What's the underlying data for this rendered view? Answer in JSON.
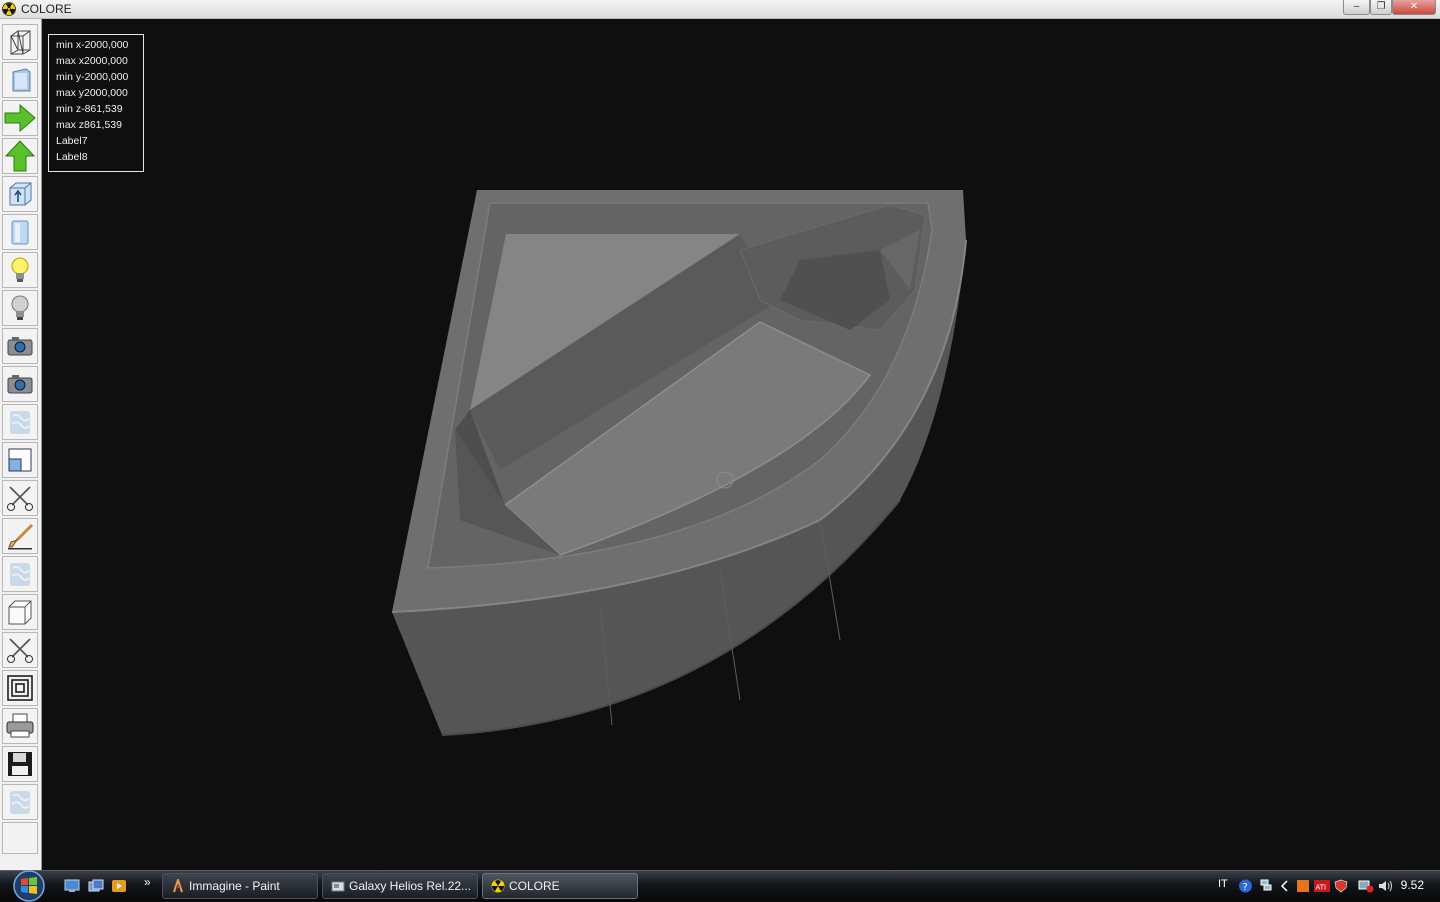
{
  "window": {
    "title": "COLORE",
    "icon": "radiation-icon"
  },
  "window_buttons": {
    "minimize": "–",
    "restore": "❐",
    "close": "✕"
  },
  "toolbar": {
    "tools": [
      {
        "name": "wireframe-tool-icon"
      },
      {
        "name": "solid-view-tool-icon"
      },
      {
        "name": "arrow-right-tool-icon"
      },
      {
        "name": "arrow-up-tool-icon"
      },
      {
        "name": "box-up-tool-icon"
      },
      {
        "name": "cylinder-tool-icon"
      },
      {
        "name": "light-on-tool-icon"
      },
      {
        "name": "light-off-tool-icon"
      },
      {
        "name": "camera-tool-icon"
      },
      {
        "name": "camera-2-tool-icon"
      },
      {
        "name": "texture-tool-icon"
      },
      {
        "name": "window-tool-icon"
      },
      {
        "name": "scissors-tool-icon"
      },
      {
        "name": "brush-tool-icon"
      },
      {
        "name": "texture-2-tool-icon"
      },
      {
        "name": "cube-tool-icon"
      },
      {
        "name": "scissors-2-tool-icon"
      },
      {
        "name": "concentric-squares-tool-icon"
      },
      {
        "name": "printer-tool-icon"
      },
      {
        "name": "save-tool-icon"
      },
      {
        "name": "texture-3-tool-icon"
      }
    ]
  },
  "info_panel": {
    "lines": [
      "min x-2000,000",
      "max x2000,000",
      "min y-2000,000",
      "max y2000,000",
      "min z-861,539",
      "max z861,539",
      "Label7",
      "Label8"
    ]
  },
  "viewport": {
    "model": "corner-bathtub-3d-model",
    "background": "#0f0f0f",
    "model_color": "#6e6e6e"
  },
  "taskbar": {
    "quick_launch": [
      {
        "name": "show-desktop-icon"
      },
      {
        "name": "switch-windows-icon"
      },
      {
        "name": "media-player-icon"
      }
    ],
    "overflow": "»",
    "tasks": [
      {
        "label": "Immagine - Paint",
        "icon": "paint-icon"
      },
      {
        "label": "Galaxy Helios  Rel.22...",
        "icon": "app-icon"
      },
      {
        "label": "COLORE",
        "icon": "radiation-icon",
        "active": true
      }
    ],
    "language": "IT",
    "clock": "9.52"
  }
}
